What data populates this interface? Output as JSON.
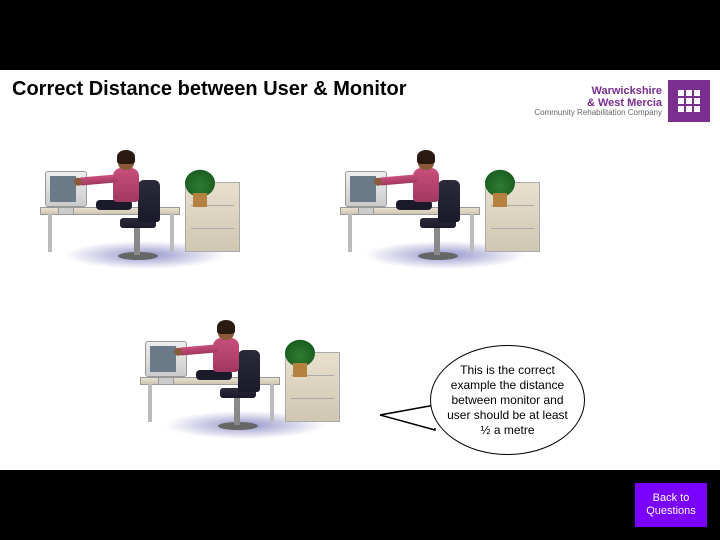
{
  "slide": {
    "title": "Correct Distance between User & Monitor"
  },
  "logo": {
    "line1": "Warwickshire",
    "line2": "& West Mercia",
    "line3": "Community Rehabilitation Company"
  },
  "callout": {
    "text": "This is the correct example the distance between monitor and user should be at least ½ a metre"
  },
  "buttons": {
    "back": "Back to Questions"
  }
}
